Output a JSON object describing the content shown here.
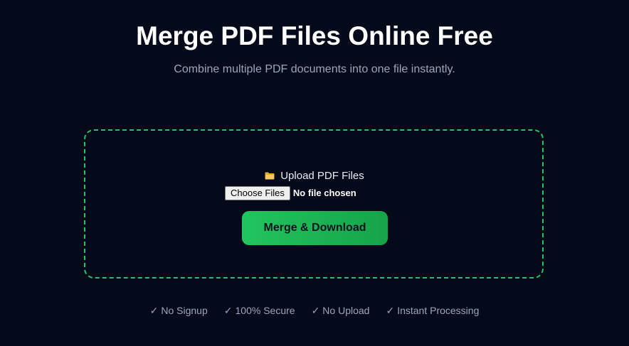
{
  "header": {
    "title": "Merge PDF Files Online Free",
    "subtitle": "Combine multiple PDF documents into one file instantly."
  },
  "uploader": {
    "icon": "folder-icon",
    "label": "Upload PDF Files",
    "choose_button_label": "Choose Files",
    "file_status": "No file chosen",
    "accent_color": "#22c55e"
  },
  "action": {
    "merge_button_label": "Merge & Download"
  },
  "features": [
    {
      "check": "✓",
      "label": "No Signup"
    },
    {
      "check": "✓",
      "label": "100% Secure"
    },
    {
      "check": "✓",
      "label": "No Upload"
    },
    {
      "check": "✓",
      "label": "Instant Processing"
    }
  ],
  "colors": {
    "background": "#050a1a",
    "button_green": "#22c55e",
    "muted_text": "#9aa6bd"
  }
}
